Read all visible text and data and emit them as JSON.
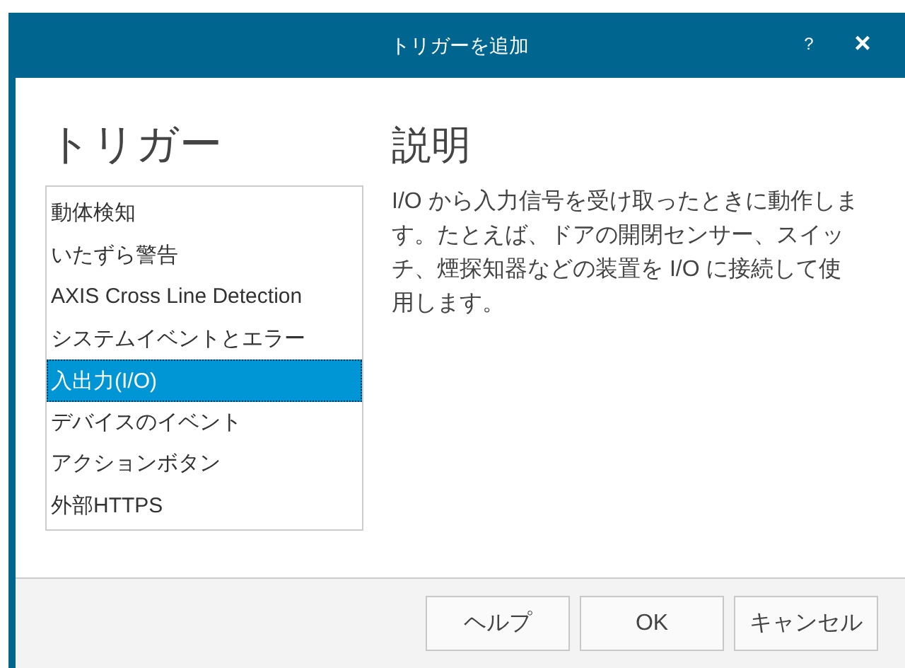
{
  "window": {
    "title": "トリガーを追加",
    "help": "?",
    "close": "×"
  },
  "trigger_heading": "トリガー",
  "triggers": [
    {
      "label": "動体検知",
      "selected": false
    },
    {
      "label": "いたずら警告",
      "selected": false
    },
    {
      "label": "AXIS Cross Line Detection",
      "selected": false
    },
    {
      "label": "システムイベントとエラー",
      "selected": false
    },
    {
      "label": "入出力(I/O)",
      "selected": true
    },
    {
      "label": "デバイスのイベント",
      "selected": false
    },
    {
      "label": "アクションボタン",
      "selected": false
    },
    {
      "label": "外部HTTPS",
      "selected": false
    }
  ],
  "description": {
    "heading": "説明",
    "text": "I/O から入力信号を受け取ったときに動作します。たとえば、ドアの開閉センサー、スイッチ、煙探知器などの装置を I/O に接続して使用します。"
  },
  "buttons": [
    "ヘルプ",
    "OK",
    "キャンセル"
  ]
}
